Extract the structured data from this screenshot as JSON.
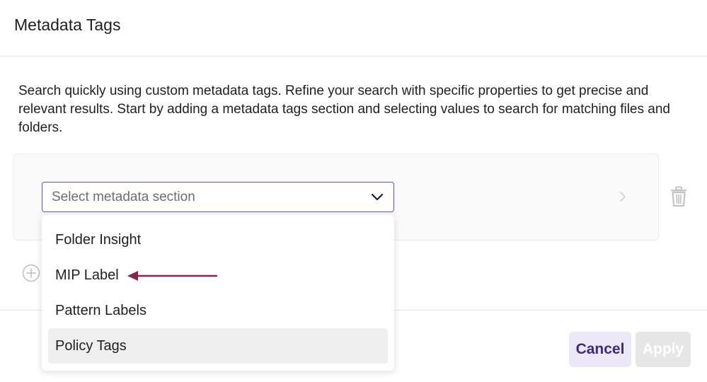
{
  "header": {
    "title": "Metadata Tags"
  },
  "description": "Search quickly using custom metadata tags. Refine your search with specific properties to get precise and relevant results. Start by adding a metadata tags section and selecting values to search for matching files and folders.",
  "section_select": {
    "placeholder": "Select metadata section",
    "options": [
      {
        "label": "Folder Insight"
      },
      {
        "label": "MIP Label"
      },
      {
        "label": "Pattern Labels"
      },
      {
        "label": "Policy Tags"
      }
    ],
    "highlighted_option": "Policy Tags"
  },
  "footer": {
    "cancel_label": "Cancel",
    "apply_label": "Apply"
  },
  "colors": {
    "accent": "#6b4ad6",
    "cancel_bg": "#ece8f7",
    "cancel_text": "#3b2a86",
    "apply_disabled_bg": "#e6e6e6",
    "annotation_arrow": "#8b2252"
  }
}
